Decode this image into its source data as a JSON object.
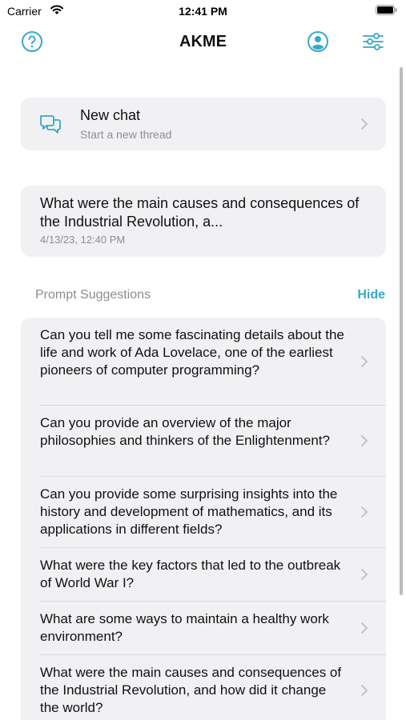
{
  "status_bar": {
    "carrier": "Carrier",
    "time": "12:41 PM",
    "wifi_icon": "wifi-icon",
    "battery_icon": "battery-icon"
  },
  "nav": {
    "title": "AKME",
    "help_icon": "help-icon",
    "profile_icon": "profile-icon",
    "settings_icon": "settings-sliders-icon"
  },
  "new_chat": {
    "title": "New chat",
    "subtitle": "Start a new thread",
    "icon": "chat-bubbles-icon"
  },
  "recent_chat": {
    "text": "What were the main causes and consequences of the Industrial Revolution, a...",
    "date": "4/13/23, 12:40 PM"
  },
  "suggestions_section": {
    "header": "Prompt Suggestions",
    "hide_label": "Hide",
    "items": [
      {
        "text": "Can you tell me some fascinating details about the life and work of Ada Lovelace, one of the earliest pioneers of computer programming?"
      },
      {
        "text": "Can you provide an overview of the major philosophies and thinkers of the Enlightenment?"
      },
      {
        "text": "Can you provide some surprising insights into the history and development of mathematics, and its applications in different fields?"
      },
      {
        "text": "What were the key factors that led to the outbreak of World War I?"
      },
      {
        "text": "What are some ways to maintain a healthy work environment?"
      },
      {
        "text": "What were the main causes and consequences of the Industrial Revolution, and how did it change the world?"
      }
    ]
  },
  "colors": {
    "accent": "#36a8c6",
    "card_bg": "#f1f1f4",
    "secondary_text": "#8e8e93"
  }
}
